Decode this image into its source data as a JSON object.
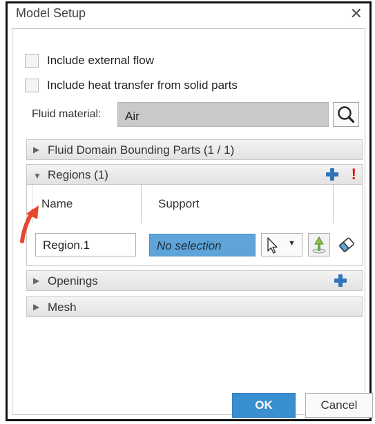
{
  "window": {
    "title": "Model Setup",
    "close_glyph": "✕"
  },
  "options": {
    "external_flow": {
      "label": "Include external flow",
      "checked": false
    },
    "heat_transfer": {
      "label": "Include heat transfer from solid parts",
      "checked": false
    }
  },
  "fluid_material": {
    "label": "Fluid material:",
    "value": "Air",
    "icon": "search-icon"
  },
  "sections": {
    "bounding_parts": {
      "label": "Fluid Domain Bounding Parts (1 / 1)",
      "expanded": false
    },
    "regions": {
      "label": "Regions (1)",
      "expanded": true,
      "warning_glyph": "!",
      "columns": [
        "Name",
        "Support"
      ],
      "rows": [
        {
          "name": "Region.1",
          "support": "No selection"
        }
      ]
    },
    "openings": {
      "label": "Openings",
      "expanded": false
    },
    "mesh": {
      "label": "Mesh",
      "expanded": false
    }
  },
  "glyphs": {
    "collapsed": "▶",
    "expanded": "▼",
    "dropdown": "▼"
  },
  "buttons": {
    "ok": "OK",
    "cancel": "Cancel"
  },
  "colors": {
    "accent": "#3a8fd1",
    "selection": "#5ea4d8",
    "add": "#2f73b8",
    "warning": "#e01010",
    "annotation": "#e8452f"
  }
}
